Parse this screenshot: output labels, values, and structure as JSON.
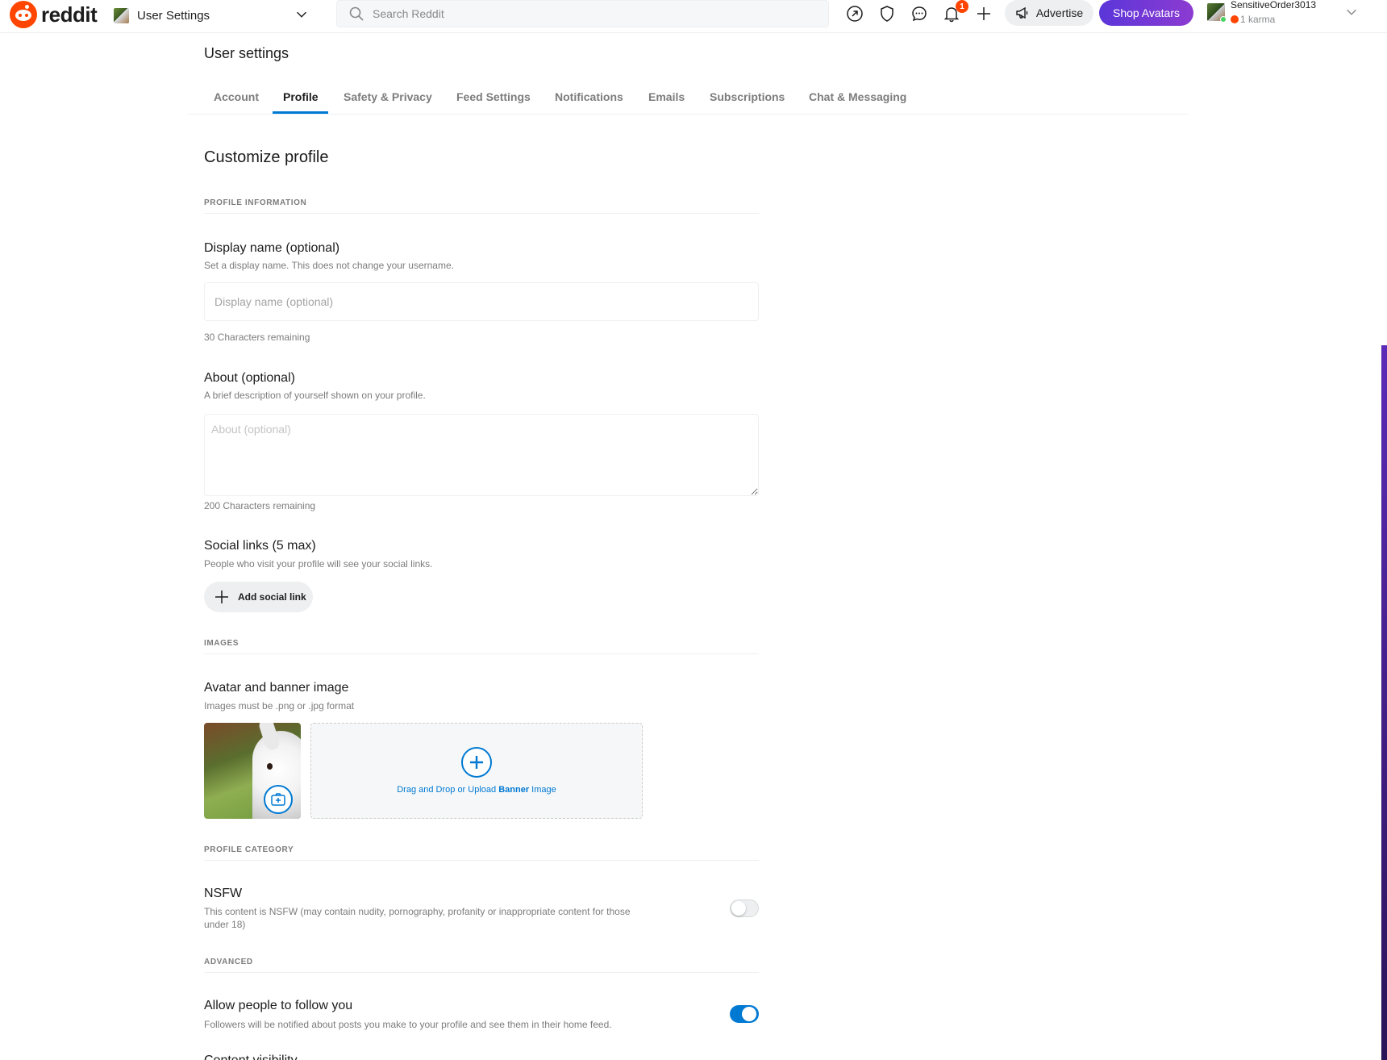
{
  "header": {
    "logo_text": "reddit",
    "community_label": "User Settings",
    "search_placeholder": "Search Reddit",
    "notification_count": "1",
    "advertise_label": "Advertise",
    "shop_label": "Shop Avatars",
    "user": {
      "name": "SensitiveOrder3013",
      "karma": "1 karma"
    }
  },
  "page": {
    "title": "User settings",
    "tabs": [
      {
        "label": "Account"
      },
      {
        "label": "Profile",
        "active": true
      },
      {
        "label": "Safety & Privacy"
      },
      {
        "label": "Feed Settings"
      },
      {
        "label": "Notifications"
      },
      {
        "label": "Emails"
      },
      {
        "label": "Subscriptions"
      },
      {
        "label": "Chat & Messaging"
      }
    ]
  },
  "profile": {
    "section_title": "Customize profile",
    "groups": {
      "info": "PROFILE INFORMATION",
      "images": "IMAGES",
      "category": "PROFILE CATEGORY",
      "advanced": "ADVANCED"
    },
    "display_name": {
      "title": "Display name (optional)",
      "desc": "Set a display name. This does not change your username.",
      "placeholder": "Display name (optional)",
      "value": "",
      "remaining": "30 Characters remaining"
    },
    "about": {
      "title": "About (optional)",
      "desc": "A brief description of yourself shown on your profile.",
      "placeholder": "About (optional)",
      "value": "",
      "remaining": "200 Characters remaining"
    },
    "social": {
      "title": "Social links (5 max)",
      "desc": "People who visit your profile will see your social links.",
      "button": "Add social link"
    },
    "images": {
      "title": "Avatar and banner image",
      "desc": "Images must be .png or .jpg format",
      "banner_prefix": "Drag and Drop or Upload ",
      "banner_bold": "Banner",
      "banner_suffix": " Image"
    },
    "nsfw": {
      "title": "NSFW",
      "desc": "This content is NSFW (may contain nudity, pornography, profanity or inappropriate content for those under 18)",
      "enabled": false
    },
    "follow": {
      "title": "Allow people to follow you",
      "desc": "Followers will be notified about posts you make to your profile and see them in their home feed.",
      "enabled": true
    },
    "next_title": "Content visibility"
  },
  "colors": {
    "accent": "#0079d3",
    "brand": "#ff4500"
  }
}
